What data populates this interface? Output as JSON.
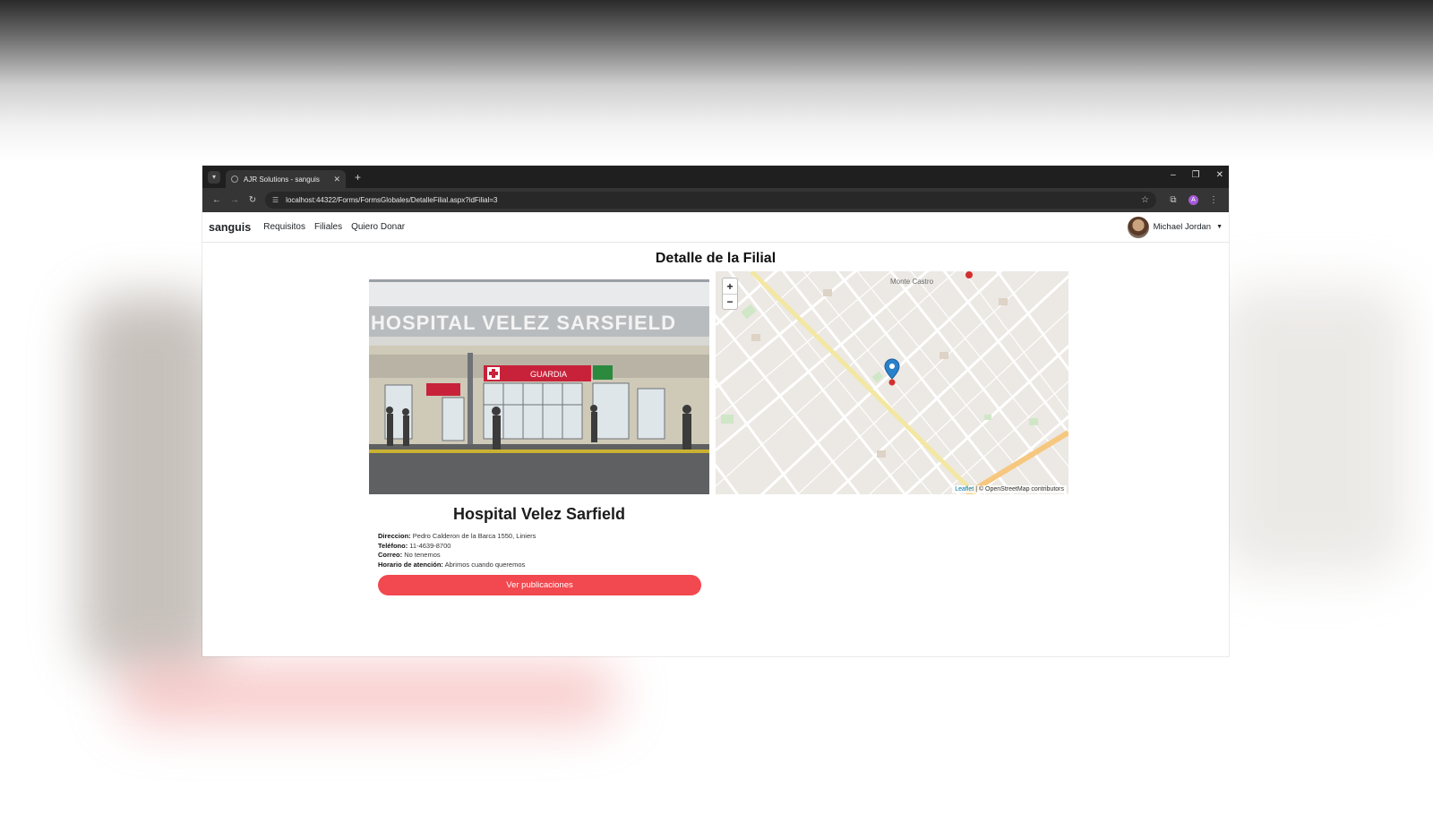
{
  "browser": {
    "tab_title": "AJR Solutions - sanguis",
    "url": "localhost:44322/Forms/FormsGlobales/DetalleFilial.aspx?idFilial=3",
    "profile_initial": "A"
  },
  "navbar": {
    "brand": "sanguis",
    "links": [
      "Requisitos",
      "Filiales",
      "Quiero Donar"
    ],
    "user_name": "Michael Jordan"
  },
  "page": {
    "title": "Detalle de la Filial"
  },
  "photo": {
    "sign_text": "HOSPITAL VELEZ SARSFIELD",
    "guardia_text": "GUARDIA"
  },
  "map": {
    "place_label": "Monte Castro",
    "attribution_leaflet": "Leaflet",
    "attribution_osm": " | © OpenStreetMap contributors",
    "zoom_in": "+",
    "zoom_out": "−"
  },
  "filial": {
    "name": "Hospital Velez Sarfield",
    "direccion_label": "Direccion:",
    "direccion": "Pedro Calderon de la Barca 1550, Liniers",
    "telefono_label": "Teléfono:",
    "telefono": "11-4639-8700",
    "correo_label": "Correo:",
    "correo": "No tenemos",
    "horario_label": "Horario de atención:",
    "horario": "Abrimos cuando queremos",
    "cta": "Ver publicaciones"
  },
  "colors": {
    "accent": "#f2484f",
    "map_pin": "#2a81cb"
  }
}
